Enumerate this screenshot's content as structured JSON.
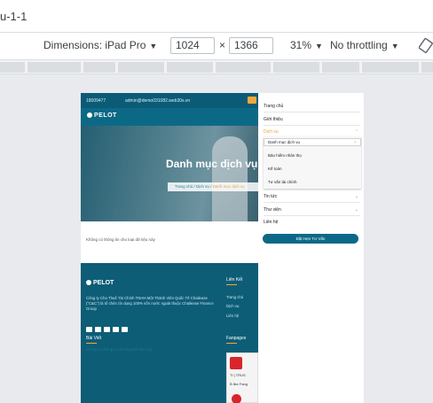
{
  "browser": {
    "url_fragment": "u-1-1",
    "device_label": "Dimensions: iPad Pro",
    "width": "1024",
    "height": "1366",
    "times": "×",
    "zoom": "31%",
    "throttle": "No throttling"
  },
  "site": {
    "phone": "18009477",
    "email": "admin@demo031082.web30s.vn",
    "logo": "PELOT",
    "hero_title": "Danh mục dịch vụ",
    "breadcrumb": [
      "Trang chủ",
      "Dịch vụ",
      "Danh mục dịch vụ"
    ],
    "notice": "Không có thông tin cho loại dữ liệu này",
    "footer": {
      "logo": "PELOT",
      "description": "Công ty Cho Thuê Tài Chính TNHH Một Thành Viên Quốc Tế Chailease (\"C&C\") là tổ chức tín dụng 100% vốn nước ngoài thuộc Chailease Finance Group",
      "links_title": "Liên Kết",
      "links": [
        "Trang chủ",
        "Dịch vụ",
        "Liên hệ"
      ],
      "posts_title": "Bài Viết",
      "posts_notice": "Không có thông tin cho loại dữ liệu này",
      "fanpage_title": "Fanpages",
      "fanpage_text1": "TI | TRUS",
      "fanpage_text2": "B like Fang"
    },
    "menu": {
      "items": [
        "Trang chủ",
        "Giới thiệu",
        "Dịch vụ",
        "Tin tức",
        "Thư viện",
        "Liên hệ"
      ],
      "submenu": [
        "Danh mục dịch vụ",
        "Bảo hiểm nhân thọ",
        "Kế toán",
        "Tư vấn tài chính"
      ],
      "cta": "Đặt Hẹn Tư Vấn"
    },
    "colors": {
      "primary": "#0c6986",
      "accent": "#e8a23a"
    }
  }
}
